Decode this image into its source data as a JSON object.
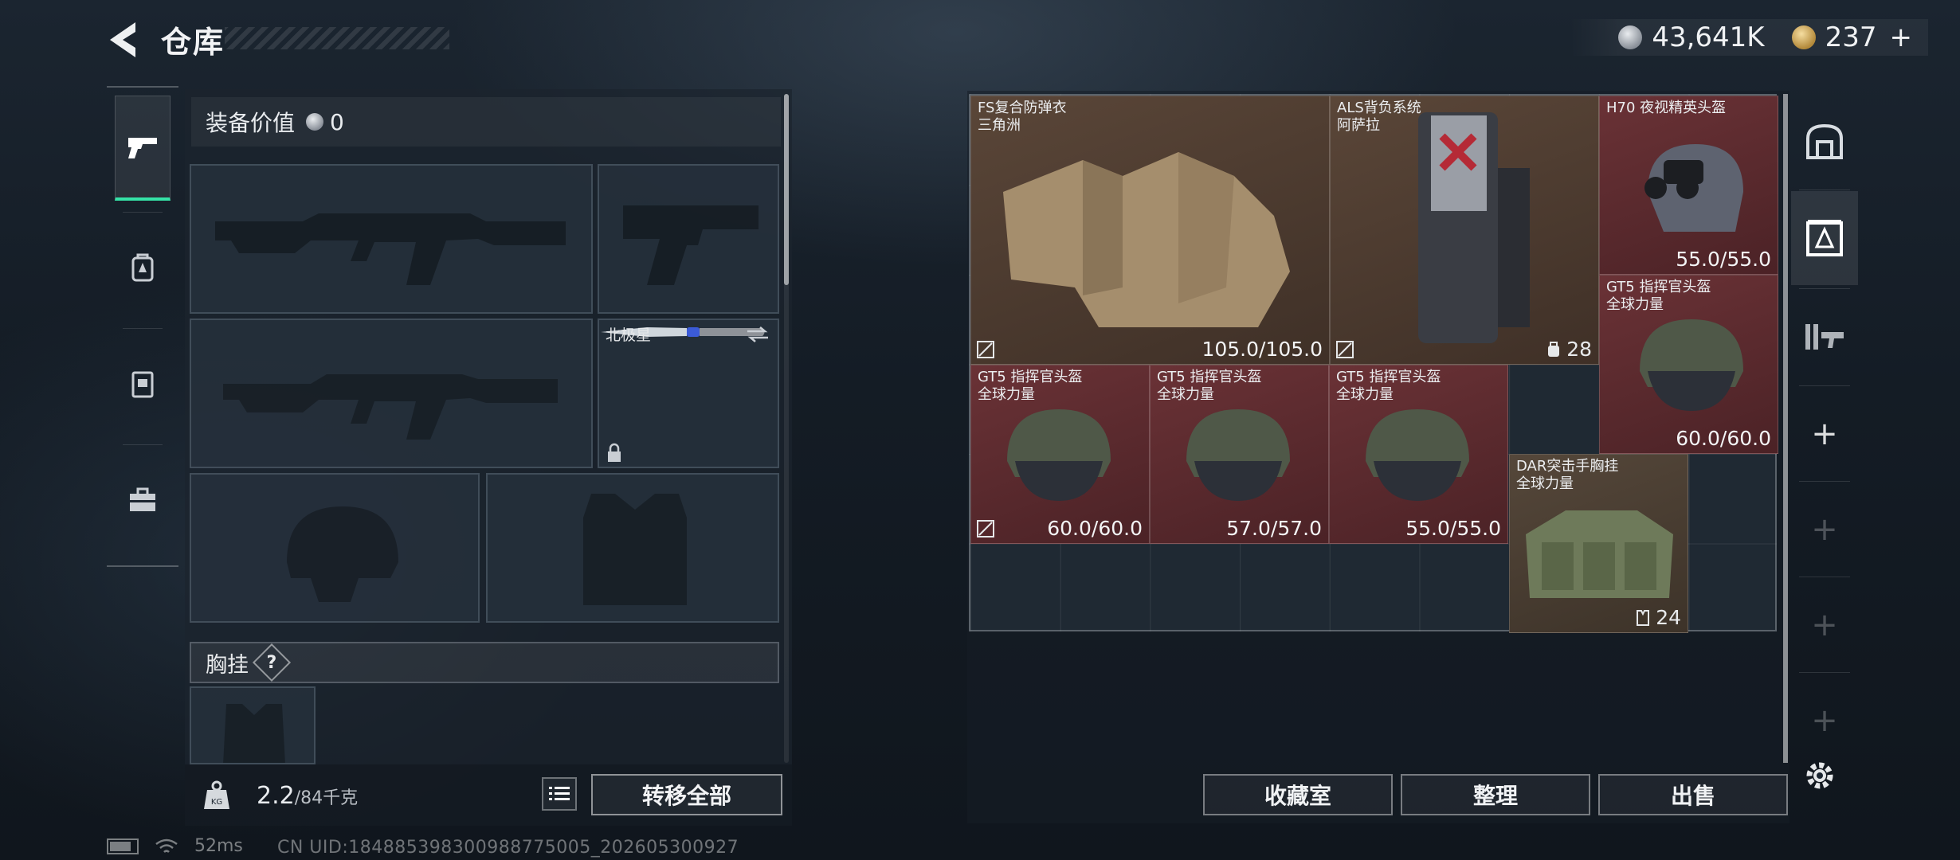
{
  "header": {
    "title": "仓库",
    "currency_silver": "43,641K",
    "currency_gold": "237",
    "currency_gold_plus": "+"
  },
  "equipment": {
    "value_label": "装备价值",
    "value": "0",
    "melee_name": "北极星",
    "chest_label": "胸挂",
    "chest_help": "?",
    "weight_current": "2.2",
    "weight_max": "/84千克",
    "transfer_all": "转移全部"
  },
  "storage": {
    "items": [
      {
        "name1": "FS复合防弹衣",
        "name2": "三角洲",
        "value": "105.0/105.0",
        "color": "#5a4638"
      },
      {
        "name1": "ALS背负系统",
        "name2": "阿萨拉",
        "count": "28",
        "color": "#4a3a30"
      },
      {
        "name1": "H70 夜视精英头盔",
        "name2": "",
        "value": "55.0/55.0",
        "color": "#6a3236"
      },
      {
        "name1": "GT5 指挥官头盔",
        "name2": "全球力量",
        "value": "60.0/60.0",
        "color": "#6a3236"
      },
      {
        "name1": "GT5 指挥官头盔",
        "name2": "全球力量",
        "value": "60.0/60.0",
        "color": "#6a3236"
      },
      {
        "name1": "GT5 指挥官头盔",
        "name2": "全球力量",
        "value": "57.0/57.0",
        "color": "#6a3236"
      },
      {
        "name1": "GT5 指挥官头盔",
        "name2": "全球力量",
        "value": "55.0/55.0",
        "color": "#6a3236"
      },
      {
        "name1": "DAR突击手胸挂",
        "name2": "全球力量",
        "count": "24",
        "color": "#55473a"
      }
    ],
    "buttons": {
      "collection": "收藏室",
      "organize": "整理",
      "sell": "出售"
    },
    "side_plus": "+"
  },
  "status": {
    "ping": "52ms",
    "uid": "CN UID:184885398300988775005_202605300927"
  },
  "icons": {
    "back": "back-arrow-icon",
    "rail": [
      "pistol-icon",
      "backpack-icon",
      "vest-icon",
      "toolbox-icon"
    ],
    "side": [
      "safebox-icon",
      "storage-icon",
      "weapons-rack-icon"
    ],
    "settings": "gear-icon"
  },
  "colors": {
    "active_accent": "#35e3a7",
    "item_red": "#6a3236",
    "item_brown": "#5a4638"
  }
}
